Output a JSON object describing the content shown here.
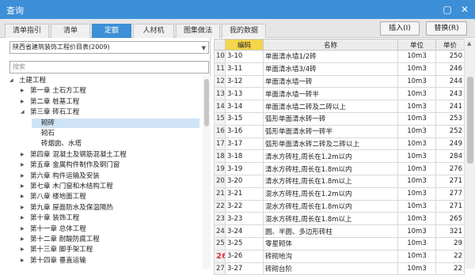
{
  "window": {
    "title": "查询"
  },
  "tabs": [
    "清单指引",
    "清单",
    "定额",
    "人材机",
    "图集做法",
    "我的数据"
  ],
  "active_tab": 2,
  "buttons": {
    "insert": "插入(I)",
    "replace": "替换(R)"
  },
  "left": {
    "library_select": "陕西省建筑装饰工程价目表(2009)",
    "search_placeholder": "搜索",
    "tree": [
      {
        "label": "土建工程",
        "level": 0,
        "arrow": "open"
      },
      {
        "label": "第一章 土石方工程",
        "level": 1,
        "arrow": "closed"
      },
      {
        "label": "第二章 桩基工程",
        "level": 1,
        "arrow": "closed"
      },
      {
        "label": "第三章 砖石工程",
        "level": 1,
        "arrow": "open"
      },
      {
        "label": "砌砖",
        "level": 2,
        "arrow": "none",
        "selected": true
      },
      {
        "label": "砌石",
        "level": 2,
        "arrow": "none"
      },
      {
        "label": "砖烟囱、水塔",
        "level": 2,
        "arrow": "none"
      },
      {
        "label": "第四章 混凝土及钢筋混凝土工程",
        "level": 1,
        "arrow": "closed"
      },
      {
        "label": "第五章 金属构件制作及钢门窗",
        "level": 1,
        "arrow": "closed"
      },
      {
        "label": "第六章 构件运输及安装",
        "level": 1,
        "arrow": "closed"
      },
      {
        "label": "第七章 木门窗和木结构工程",
        "level": 1,
        "arrow": "closed"
      },
      {
        "label": "第八章 楼地面工程",
        "level": 1,
        "arrow": "closed"
      },
      {
        "label": "第九章 屋面防水及保温隔热",
        "level": 1,
        "arrow": "closed"
      },
      {
        "label": "第十章 装饰工程",
        "level": 1,
        "arrow": "closed"
      },
      {
        "label": "第十一章 总体工程",
        "level": 1,
        "arrow": "closed"
      },
      {
        "label": "第十二章 耐酸防腐工程",
        "level": 1,
        "arrow": "closed"
      },
      {
        "label": "第十三章 脚手架工程",
        "level": 1,
        "arrow": "closed"
      },
      {
        "label": "第十四章 垂直运输",
        "level": 1,
        "arrow": "closed"
      }
    ]
  },
  "table": {
    "headers": {
      "code": "编码",
      "name": "名称",
      "unit": "单位",
      "price": "单价"
    },
    "rows": [
      {
        "n": "10",
        "code": "3-10",
        "name": "单面清水墙1/2砖",
        "unit": "10m3",
        "price": "250"
      },
      {
        "n": "11",
        "code": "3-11",
        "name": "单面清水墙3/4砖",
        "unit": "10m3",
        "price": "246"
      },
      {
        "n": "12",
        "code": "3-12",
        "name": "单面清水墙一砖",
        "unit": "10m3",
        "price": "244"
      },
      {
        "n": "13",
        "code": "3-13",
        "name": "单面清水墙一砖半",
        "unit": "10m3",
        "price": "243"
      },
      {
        "n": "14",
        "code": "3-14",
        "name": "单面清水墙二砖及二砖以上",
        "unit": "10m3",
        "price": "241"
      },
      {
        "n": "15",
        "code": "3-15",
        "name": "弧形单面清水砖一砖",
        "unit": "10m3",
        "price": "253"
      },
      {
        "n": "16",
        "code": "3-16",
        "name": "弧形单面清水砖一砖半",
        "unit": "10m3",
        "price": "252"
      },
      {
        "n": "17",
        "code": "3-17",
        "name": "弧形单面清水砖二砖及二砖以上",
        "unit": "10m3",
        "price": "249"
      },
      {
        "n": "18",
        "code": "3-18",
        "name": "清水方砖柱,周长在1.2m以内",
        "unit": "10m3",
        "price": "284"
      },
      {
        "n": "19",
        "code": "3-19",
        "name": "清水方砖柱,周长在1.8m以内",
        "unit": "10m3",
        "price": "276"
      },
      {
        "n": "20",
        "code": "3-20",
        "name": "清水方砖柱,周长在1.8m以上",
        "unit": "10m3",
        "price": "271"
      },
      {
        "n": "21",
        "code": "3-21",
        "name": "混水方砖柱,周长在1.2m以内",
        "unit": "10m3",
        "price": "277"
      },
      {
        "n": "22",
        "code": "3-22",
        "name": "混水方砖柱,周长在1.8m以内",
        "unit": "10m3",
        "price": "271"
      },
      {
        "n": "23",
        "code": "3-23",
        "name": "混水方砖柱,周长在1.8m以上",
        "unit": "10m3",
        "price": "265"
      },
      {
        "n": "24",
        "code": "3-24",
        "name": "圆、半圆、多边形砖柱",
        "unit": "10m3",
        "price": "321"
      },
      {
        "n": "25",
        "code": "3-25",
        "name": "零星砌体",
        "unit": "10m3",
        "price": "29"
      },
      {
        "n": "26",
        "code": "3-26",
        "name": "砖砌地沟",
        "unit": "10m3",
        "price": "22"
      },
      {
        "n": "27",
        "code": "3-27",
        "name": "砖砌台阶",
        "unit": "10m3",
        "price": "22"
      }
    ],
    "current_row": 16
  }
}
